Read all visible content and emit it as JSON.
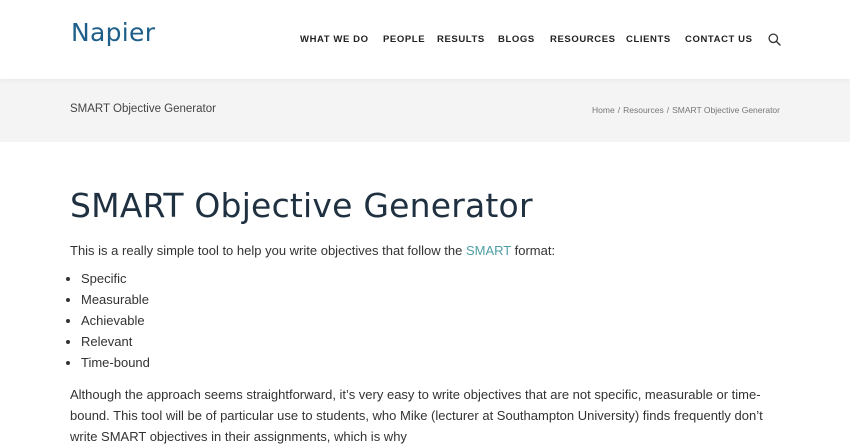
{
  "header": {
    "logo": "Napier",
    "nav": [
      "WHAT WE DO",
      "PEOPLE",
      "RESULTS",
      "BLOGS",
      "RESOURCES",
      "CLIENTS",
      "CONTACT US"
    ],
    "search_icon": "search-icon"
  },
  "crumbbar": {
    "title": "SMART Objective Generator",
    "breadcrumb": [
      "Home",
      "Resources",
      "SMART Objective Generator"
    ],
    "separator": "/"
  },
  "main": {
    "heading": "SMART Objective Generator",
    "intro_before": "This is a really simple tool to help you write objectives that follow the ",
    "intro_link": "SMART",
    "intro_after": " format:",
    "list": [
      "Specific",
      "Measurable",
      "Achievable",
      "Relevant",
      "Time-bound"
    ],
    "paragraph": "Although the approach seems straightforward, it’s very easy to write objectives that are not specific, measurable or time-bound. This tool will be of particular use to students, who Mike (lecturer at Southampton University)  finds frequently don’t write SMART objectives in their assignments, which is why"
  },
  "colors": {
    "link": "#4f9fa6",
    "logo": "#1e5f8a",
    "heading": "#1f3040",
    "crumbbar_bg": "#f4f4f4"
  }
}
